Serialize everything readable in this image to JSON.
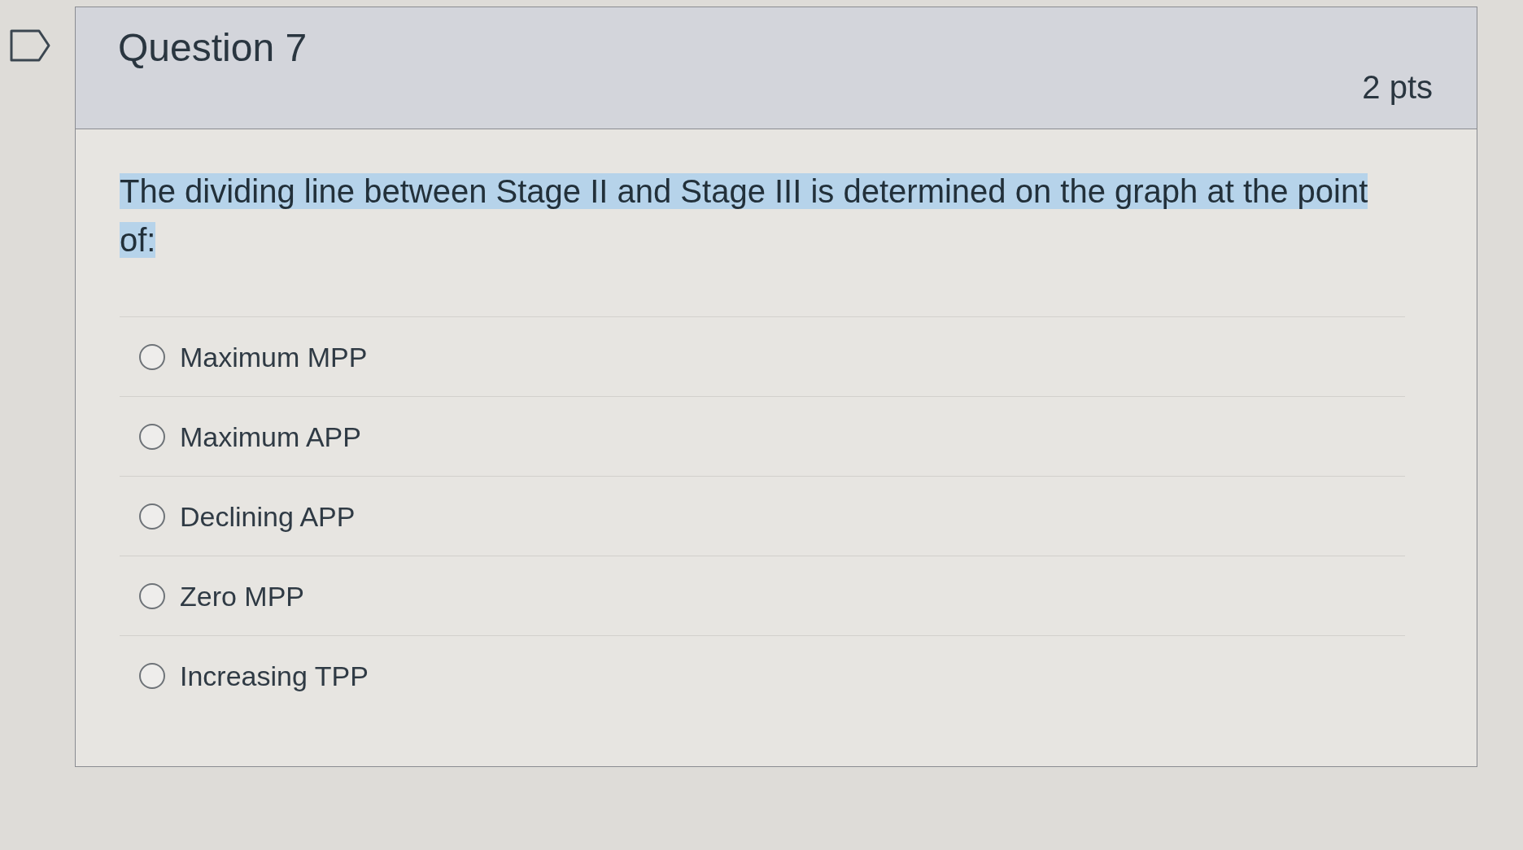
{
  "question": {
    "flagged": false,
    "title": "Question 7",
    "points": "2 pts",
    "text": "The dividing line between Stage II and Stage III is determined on the graph at the point of:",
    "highlighted": true
  },
  "answers": [
    {
      "label": "Maximum MPP",
      "selected": false
    },
    {
      "label": "Maximum APP",
      "selected": false
    },
    {
      "label": "Declining APP",
      "selected": false
    },
    {
      "label": "Zero MPP",
      "selected": false
    },
    {
      "label": "Increasing TPP",
      "selected": false
    }
  ]
}
